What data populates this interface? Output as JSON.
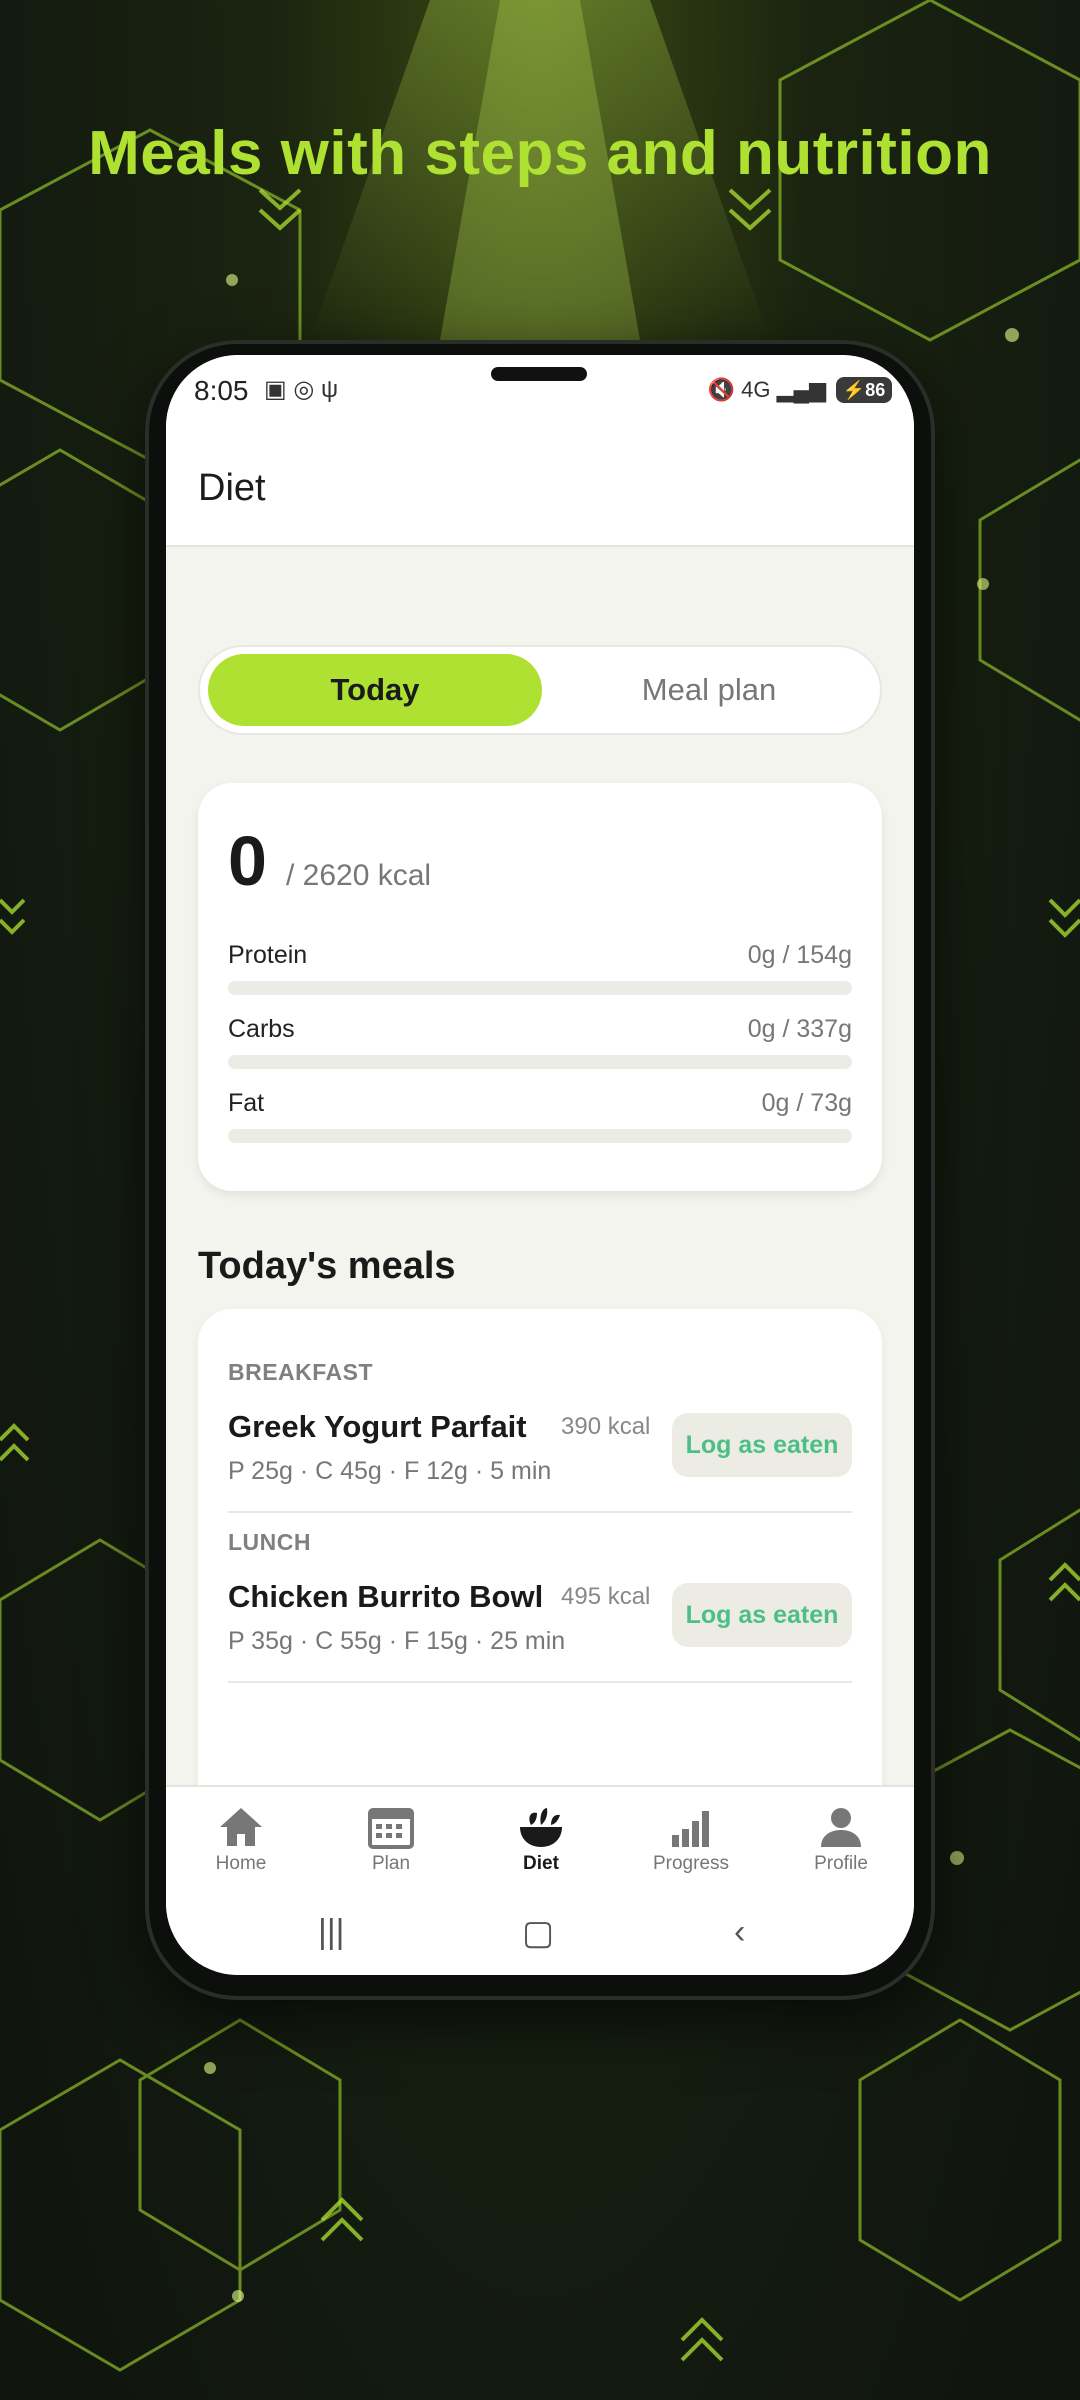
{
  "headline": "Meals with steps and nutrition",
  "status_bar": {
    "time": "8:05",
    "network": "4G",
    "battery": "86"
  },
  "app_bar": {
    "title": "Diet"
  },
  "segmented": {
    "active": "Today",
    "inactive": "Meal plan"
  },
  "summary": {
    "consumed": "0",
    "target": "/ 2620 kcal",
    "macros": [
      {
        "name": "Protein",
        "value": "0g / 154g",
        "progress": 0
      },
      {
        "name": "Carbs",
        "value": "0g / 337g",
        "progress": 0
      },
      {
        "name": "Fat",
        "value": "0g / 73g",
        "progress": 0
      }
    ]
  },
  "meals_section": {
    "title": "Today's meals",
    "meals": [
      {
        "type": "BREAKFAST",
        "name": "Greek Yogurt Parfait",
        "kcal": "390 kcal",
        "macros": "P 25g · C 45g · F 12g · 5 min",
        "action": "Log as eaten"
      },
      {
        "type": "LUNCH",
        "name": "Chicken Burrito Bowl",
        "kcal": "495 kcal",
        "macros": "P 35g · C 55g · F 15g · 25 min",
        "action": "Log as eaten"
      }
    ]
  },
  "bottom_nav": {
    "items": [
      {
        "label": "Home",
        "icon": "home-icon"
      },
      {
        "label": "Plan",
        "icon": "calendar-icon"
      },
      {
        "label": "Diet",
        "icon": "salad-bowl-icon",
        "active": true
      },
      {
        "label": "Progress",
        "icon": "bar-chart-icon"
      },
      {
        "label": "Profile",
        "icon": "person-icon"
      }
    ]
  },
  "colors": {
    "accent": "#aee131",
    "action_text": "#4cbf86",
    "background": "#f4f4ef"
  }
}
